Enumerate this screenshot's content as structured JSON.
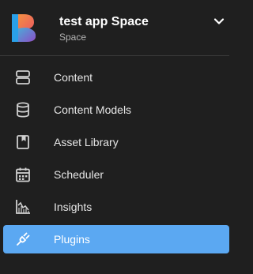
{
  "space": {
    "name": "test app Space",
    "type": "Space"
  },
  "nav": {
    "items": [
      {
        "label": "Content",
        "icon": "content-icon"
      },
      {
        "label": "Content Models",
        "icon": "database-icon"
      },
      {
        "label": "Asset Library",
        "icon": "asset-library-icon"
      },
      {
        "label": "Scheduler",
        "icon": "calendar-icon"
      },
      {
        "label": "Insights",
        "icon": "chart-icon"
      },
      {
        "label": "Plugins",
        "icon": "plug-icon",
        "active": true
      }
    ]
  },
  "colors": {
    "background": "#1f1f1f",
    "active_item": "#5ba8f2",
    "divider": "#3a3a3a"
  }
}
